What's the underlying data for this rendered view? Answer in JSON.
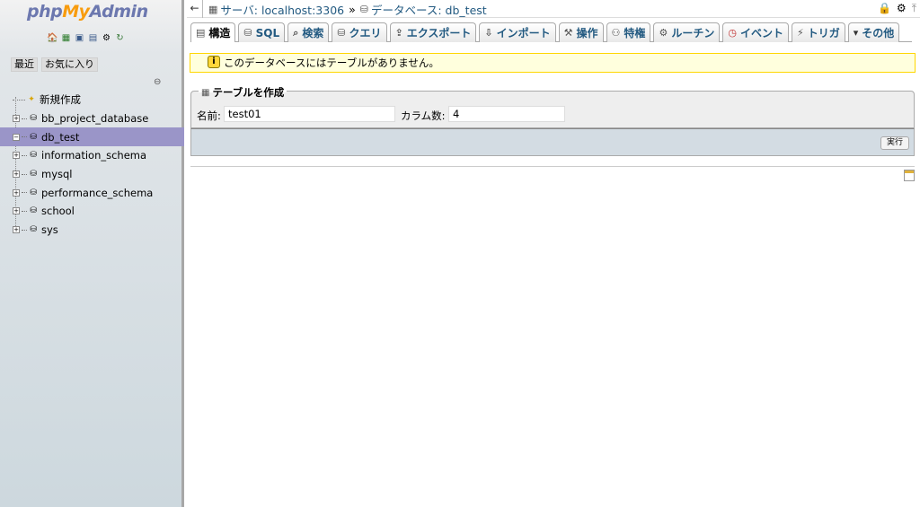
{
  "nav": {
    "logo_part1": "php",
    "logo_part2": "My",
    "logo_part3": "Admin",
    "links": [
      "最近",
      "お気に入り"
    ],
    "new_label": "新規作成",
    "databases": [
      "bb_project_database",
      "db_test",
      "information_schema",
      "mysql",
      "performance_schema",
      "school",
      "sys"
    ],
    "active_database": "db_test"
  },
  "breadcrumb": {
    "server_label": "サーバ: localhost:3306",
    "separator": "»",
    "database_label": "データベース: db_test"
  },
  "tabs": [
    {
      "label": "構造",
      "icon": "structure-icon",
      "active": true
    },
    {
      "label": "SQL",
      "icon": "sql-icon",
      "active": false
    },
    {
      "label": "検索",
      "icon": "search-icon",
      "active": false
    },
    {
      "label": "クエリ",
      "icon": "query-icon",
      "active": false
    },
    {
      "label": "エクスポート",
      "icon": "export-icon",
      "active": false
    },
    {
      "label": "インポート",
      "icon": "import-icon",
      "active": false
    },
    {
      "label": "操作",
      "icon": "operations-icon",
      "active": false
    },
    {
      "label": "特権",
      "icon": "privileges-icon",
      "active": false
    },
    {
      "label": "ルーチン",
      "icon": "routines-icon",
      "active": false
    },
    {
      "label": "イベント",
      "icon": "events-icon",
      "active": false
    },
    {
      "label": "トリガ",
      "icon": "triggers-icon",
      "active": false
    },
    {
      "label": "その他",
      "icon": "more-icon",
      "active": false
    }
  ],
  "notice": {
    "icon": "i",
    "text": "このデータベースにはテーブルがありません。"
  },
  "create_table": {
    "legend": "テーブルを作成",
    "name_label": "名前:",
    "name_value": "test01",
    "columns_label": "カラム数:",
    "columns_value": "4",
    "go_label": "実行"
  },
  "colors": {
    "link": "#235a81",
    "active_tree_row": "#9a95c8",
    "notice_bg": "#ffffdd",
    "notice_border": "#ffd700",
    "footer_bg": "#d3dce3"
  }
}
